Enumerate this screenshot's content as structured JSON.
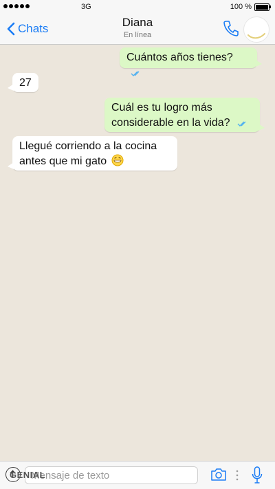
{
  "status_bar": {
    "network": "3G",
    "battery": "100 %"
  },
  "nav": {
    "back_label": "Chats",
    "contact_name": "Diana",
    "contact_status": "En línea"
  },
  "messages": [
    {
      "text": "Cuántos años tienes?",
      "direction": "outgoing"
    },
    {
      "text": "27",
      "direction": "incoming"
    },
    {
      "text": "Cuál es tu logro más considerable en la vida?",
      "direction": "outgoing"
    },
    {
      "text": "Llegué corriendo a la cocina antes que mi gato",
      "direction": "incoming",
      "emoji": "grinning-face"
    }
  ],
  "input": {
    "placeholder": "Mensaje de texto",
    "watermark": "GENIAL"
  },
  "colors": {
    "accent": "#1a7cf5",
    "outgoing_bubble": "#dcf8c6",
    "incoming_bubble": "#ffffff",
    "chat_background": "#ece6dc",
    "read_ticks": "#4fb0f0"
  }
}
